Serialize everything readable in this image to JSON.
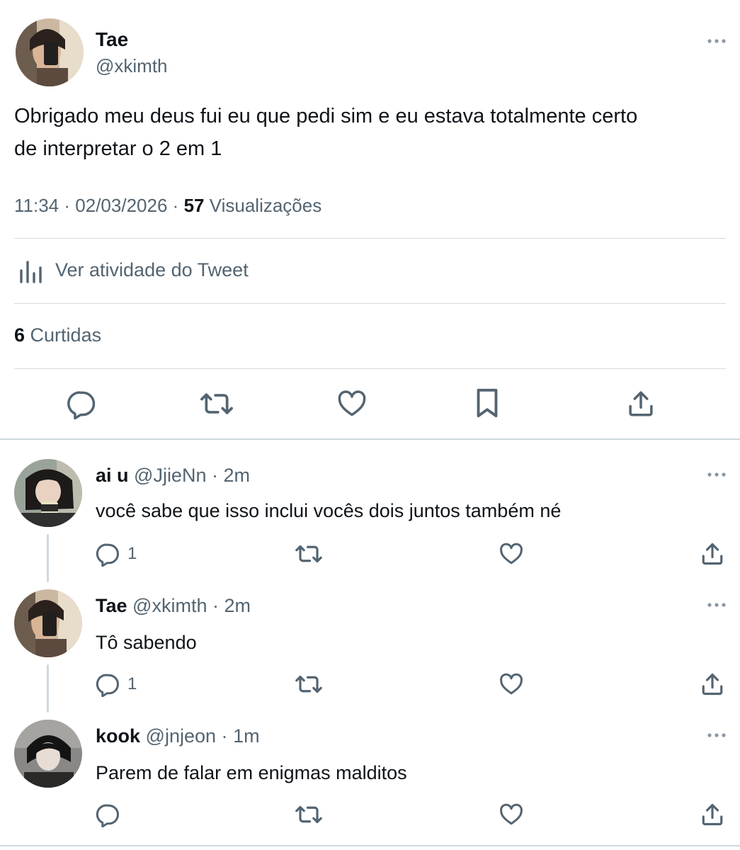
{
  "main_tweet": {
    "author_name": "Tae",
    "author_handle": "@xkimth",
    "text_line1": "Obrigado meu deus fui eu que pedi sim e eu estava totalmente certo",
    "text_line2": "de interpretar o 2 em 1",
    "time": "11:34",
    "sep1": "·",
    "date": "02/03/2026",
    "sep2": "·",
    "views_count": "57",
    "views_label": "Visualizações",
    "activity_label": "Ver atividade do Tweet",
    "likes_count": "6",
    "likes_label": "Curtidas"
  },
  "replies": [
    {
      "name": "ai u",
      "handle": "@JjieNn",
      "dot": "·",
      "time": "2m",
      "text": "você sabe que isso inclui vocês dois juntos também né",
      "reply_count": "1"
    },
    {
      "name": "Tae",
      "handle": "@xkimth",
      "dot": "·",
      "time": "2m",
      "text": "Tô sabendo",
      "reply_count": "1"
    },
    {
      "name": "kook",
      "handle": "@jnjeon",
      "dot": "·",
      "time": "1m",
      "text": "Parem de falar em enigmas malditos",
      "reply_count": ""
    }
  ],
  "icons": {
    "more": "more-horizontal-icon",
    "reply": "reply-icon",
    "retweet": "retweet-icon",
    "like": "like-icon",
    "bookmark": "bookmark-icon",
    "share": "share-icon",
    "analytics": "analytics-icon"
  },
  "colors": {
    "text": "#0f1419",
    "muted": "#536471",
    "divider": "#d6dbdf"
  }
}
